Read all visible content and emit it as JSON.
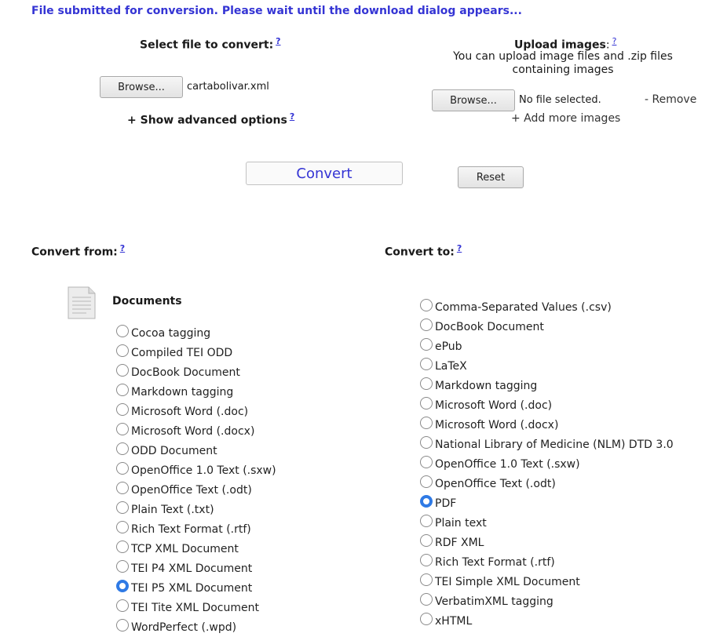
{
  "status_message": "File submitted for conversion. Please wait until the download dialog appears...",
  "help_symbol": "?",
  "select_file": {
    "label": "Select file to convert:",
    "browse_label": "Browse...",
    "file_name": "cartabolivar.xml",
    "advanced_options_label": "+ Show advanced options"
  },
  "upload_images": {
    "label": "Upload images",
    "colon": ":",
    "description": "You can upload image files and .zip files containing images",
    "browse_label": "Browse...",
    "file_name": "No file selected.",
    "remove_label": "- Remove",
    "add_more_label": "+ Add more images"
  },
  "actions": {
    "convert_label": "Convert",
    "reset_label": "Reset"
  },
  "convert_from": {
    "label": "Convert from:",
    "category": "Documents",
    "icon": "document-icon",
    "options": [
      {
        "label": "Cocoa tagging",
        "selected": false
      },
      {
        "label": "Compiled TEI ODD",
        "selected": false
      },
      {
        "label": "DocBook Document",
        "selected": false
      },
      {
        "label": "Markdown tagging",
        "selected": false
      },
      {
        "label": "Microsoft Word (.doc)",
        "selected": false
      },
      {
        "label": "Microsoft Word (.docx)",
        "selected": false
      },
      {
        "label": "ODD Document",
        "selected": false
      },
      {
        "label": "OpenOffice 1.0 Text (.sxw)",
        "selected": false
      },
      {
        "label": "OpenOffice Text (.odt)",
        "selected": false
      },
      {
        "label": "Plain Text (.txt)",
        "selected": false
      },
      {
        "label": "Rich Text Format (.rtf)",
        "selected": false
      },
      {
        "label": "TCP XML Document",
        "selected": false
      },
      {
        "label": "TEI P4 XML Document",
        "selected": false
      },
      {
        "label": "TEI P5 XML Document",
        "selected": true
      },
      {
        "label": "TEI Tite XML Document",
        "selected": false
      },
      {
        "label": "WordPerfect (.wpd)",
        "selected": false
      }
    ]
  },
  "convert_to": {
    "label": "Convert to:",
    "options": [
      {
        "label": "Comma-Separated Values (.csv)",
        "selected": false
      },
      {
        "label": "DocBook Document",
        "selected": false
      },
      {
        "label": "ePub",
        "selected": false
      },
      {
        "label": "LaTeX",
        "selected": false
      },
      {
        "label": "Markdown tagging",
        "selected": false
      },
      {
        "label": "Microsoft Word (.doc)",
        "selected": false
      },
      {
        "label": "Microsoft Word (.docx)",
        "selected": false
      },
      {
        "label": "National Library of Medicine (NLM) DTD 3.0",
        "selected": false
      },
      {
        "label": "OpenOffice 1.0 Text (.sxw)",
        "selected": false
      },
      {
        "label": "OpenOffice Text (.odt)",
        "selected": false
      },
      {
        "label": "PDF",
        "selected": true
      },
      {
        "label": "Plain text",
        "selected": false
      },
      {
        "label": "RDF XML",
        "selected": false
      },
      {
        "label": "Rich Text Format (.rtf)",
        "selected": false
      },
      {
        "label": "TEI Simple XML Document",
        "selected": false
      },
      {
        "label": "VerbatimXML tagging",
        "selected": false
      },
      {
        "label": "xHTML",
        "selected": false
      }
    ]
  },
  "colors": {
    "accent_blue": "#3434d4",
    "radio_selected": "#2f7ae5"
  }
}
